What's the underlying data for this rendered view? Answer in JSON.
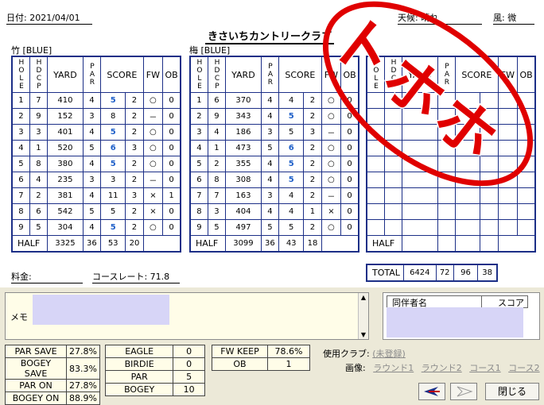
{
  "header": {
    "date": "日付: 2021/04/01",
    "weather": "天候: 晴れ",
    "wind": "風: 微",
    "course_name": "きさいちカントリークラブ"
  },
  "sections": {
    "left_label": "竹 [BLUE]",
    "right_label": "梅 [BLUE]"
  },
  "columns": {
    "hole": "HOLE",
    "hdcp": "HDCP",
    "yard": "YARD",
    "par": "PAR",
    "score": "SCORE",
    "fw": "FW",
    "ob": "OB"
  },
  "left_rows": [
    [
      "1",
      "7",
      "410",
      "4",
      "5",
      "2",
      "○",
      "0"
    ],
    [
      "2",
      "9",
      "152",
      "3",
      "8",
      "2",
      "－",
      "0"
    ],
    [
      "3",
      "3",
      "401",
      "4",
      "5",
      "2",
      "○",
      "0"
    ],
    [
      "4",
      "1",
      "520",
      "5",
      "6",
      "3",
      "○",
      "0"
    ],
    [
      "5",
      "8",
      "380",
      "4",
      "5",
      "2",
      "○",
      "0"
    ],
    [
      "6",
      "4",
      "235",
      "3",
      "3",
      "2",
      "－",
      "0"
    ],
    [
      "7",
      "2",
      "381",
      "4",
      "11",
      "3",
      "×",
      "1"
    ],
    [
      "8",
      "6",
      "542",
      "5",
      "5",
      "2",
      "×",
      "0"
    ],
    [
      "9",
      "5",
      "304",
      "4",
      "5",
      "2",
      "○",
      "0"
    ]
  ],
  "left_half": {
    "label": "HALF",
    "yard": "3325",
    "par": "36",
    "score": "53",
    "putt": "20"
  },
  "right_rows": [
    [
      "1",
      "6",
      "370",
      "4",
      "4",
      "2",
      "○",
      "0"
    ],
    [
      "2",
      "9",
      "343",
      "4",
      "5",
      "2",
      "○",
      "0"
    ],
    [
      "3",
      "4",
      "186",
      "3",
      "5",
      "3",
      "－",
      "0"
    ],
    [
      "4",
      "1",
      "473",
      "5",
      "6",
      "2",
      "○",
      "0"
    ],
    [
      "5",
      "2",
      "355",
      "4",
      "5",
      "2",
      "○",
      "0"
    ],
    [
      "6",
      "8",
      "308",
      "4",
      "5",
      "2",
      "○",
      "0"
    ],
    [
      "7",
      "7",
      "163",
      "3",
      "4",
      "2",
      "－",
      "0"
    ],
    [
      "8",
      "3",
      "404",
      "4",
      "4",
      "1",
      "×",
      "0"
    ],
    [
      "9",
      "5",
      "497",
      "5",
      "5",
      "2",
      "○",
      "0"
    ]
  ],
  "right_half": {
    "label": "HALF",
    "yard": "3099",
    "par": "36",
    "score": "43",
    "putt": "18"
  },
  "third": {
    "half_label": "HALF",
    "total_label": "TOTAL",
    "total_yard": "6424",
    "total_par": "72",
    "total_score": "96",
    "total_putt": "38"
  },
  "footer": {
    "fee": "料金:",
    "course_rate": "コースレート:  71.8"
  },
  "memo": {
    "label": "メモ"
  },
  "companions": {
    "name_header": "同伴者名",
    "score_header": "スコア"
  },
  "stats1": [
    [
      "PAR SAVE",
      "27.8%"
    ],
    [
      "BOGEY SAVE",
      "83.3%"
    ],
    [
      "PAR ON",
      "27.8%"
    ],
    [
      "BOGEY ON",
      "88.9%"
    ]
  ],
  "stats2": [
    [
      "EAGLE",
      "0"
    ],
    [
      "BIRDIE",
      "0"
    ],
    [
      "PAR",
      "5"
    ],
    [
      "BOGEY",
      "10"
    ]
  ],
  "stats3": [
    [
      "FW KEEP",
      "78.6%"
    ],
    [
      "OB",
      "1"
    ]
  ],
  "club": {
    "label": "使用クラブ:",
    "value": "(未登録)"
  },
  "images": {
    "label": "画像:",
    "links": [
      "ラウンド1",
      "ラウンド2",
      "コース1",
      "コース2"
    ]
  },
  "buttons": {
    "close": "閉じる"
  },
  "stamp": {
    "text": "トホホ"
  },
  "colors": {
    "grid": "#1c2f87",
    "score_blue": "#1e5fc8",
    "stamp_red": "#e00000"
  }
}
